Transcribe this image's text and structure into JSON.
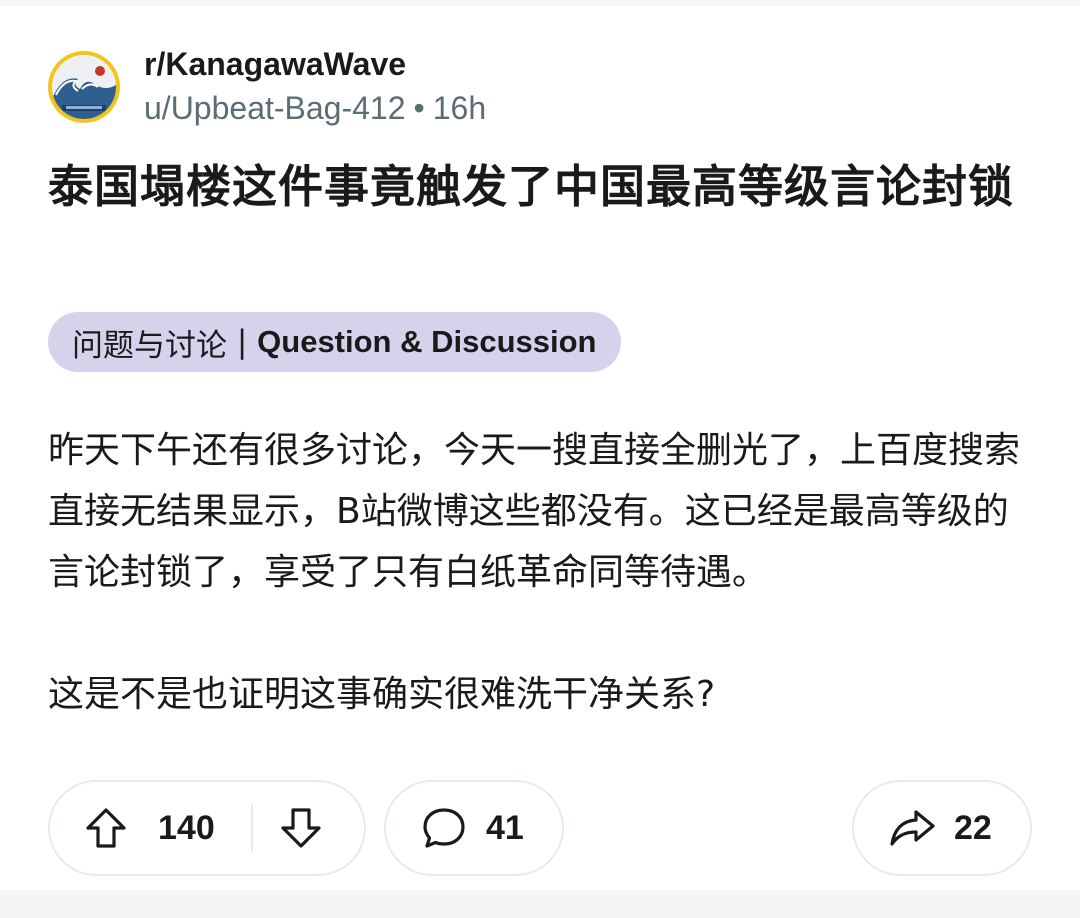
{
  "post": {
    "subreddit": "r/KanagawaWave",
    "author": "u/Upbeat-Bag-412",
    "separator": "•",
    "age": "16h",
    "title": "泰国塌楼这件事竟触发了中国最高等级言论封锁",
    "flair": {
      "zh": "问题与讨论",
      "sep": " | ",
      "en": "Question & Discussion"
    },
    "body": [
      "昨天下午还有很多讨论，今天一搜直接全删光了，上百度搜索直接无结果显示，B站微博这些都没有。这已经是最高等级的言论封锁了，享受了只有白纸革命同等待遇。",
      "这是不是也证明这事确实很难洗干净关系?"
    ]
  },
  "actions": {
    "upvote_icon": "arrow-up-icon",
    "downvote_icon": "arrow-down-icon",
    "comment_icon": "comment-bubble-icon",
    "share_icon": "share-arrow-icon",
    "vote_count": "140",
    "comment_count": "41",
    "share_count": "22"
  },
  "colors": {
    "avatar_ring": "#f3c51a",
    "flair_bg": "#d5d3ec",
    "byline": "#5c6c74",
    "pill_border": "#e5ebee"
  }
}
